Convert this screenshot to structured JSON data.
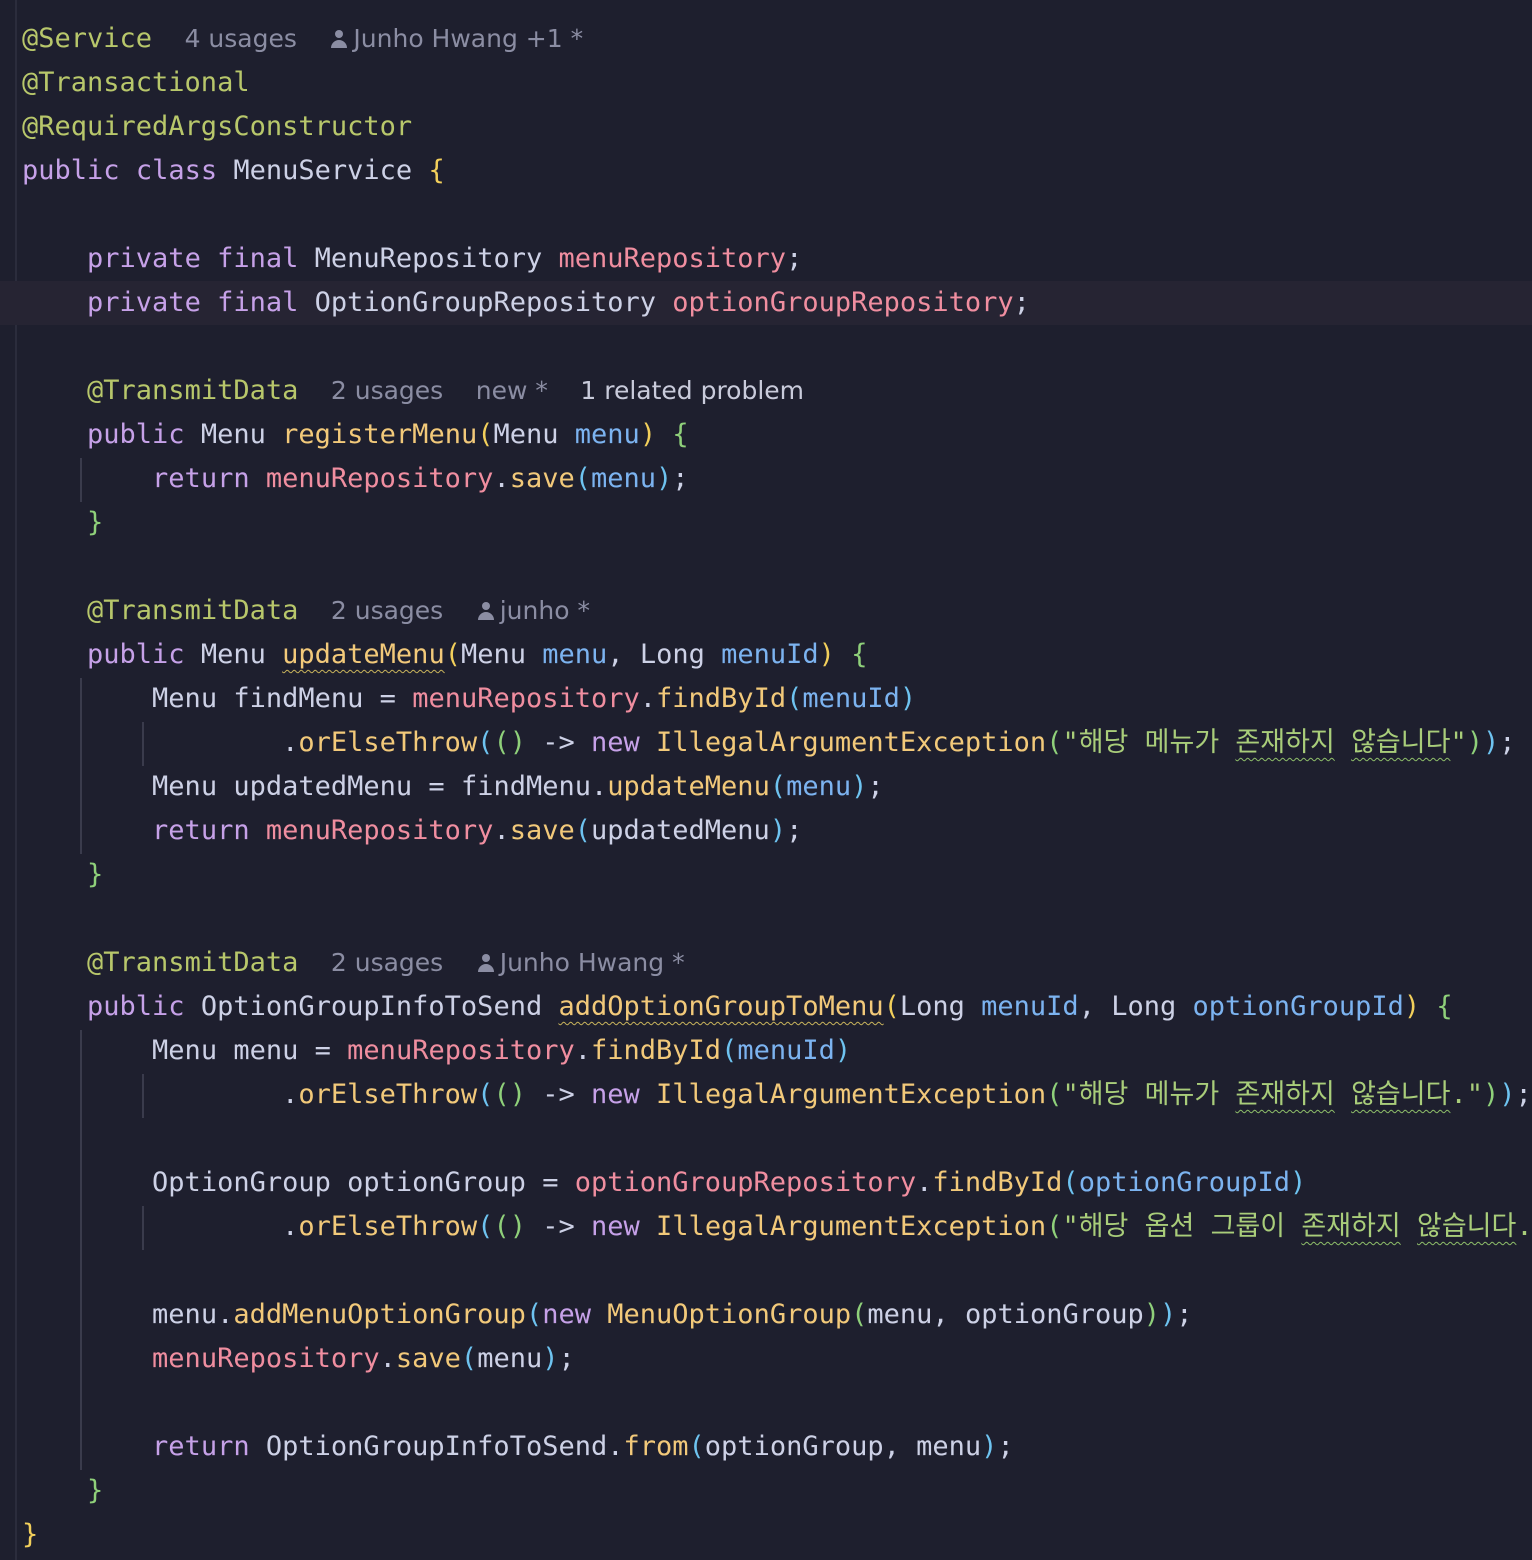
{
  "code": {
    "l1": {
      "ann": "@Service",
      "usages": "4 usages",
      "author": "Junho Hwang +1 *"
    },
    "l2": {
      "ann": "@Transactional"
    },
    "l3": {
      "ann": "@RequiredArgsConstructor"
    },
    "l4": {
      "kw1": "public",
      "kw2": "class",
      "name": "MenuService",
      "brace": "{"
    },
    "l6": {
      "kw1": "private",
      "kw2": "final",
      "type": "MenuRepository",
      "field": "menuRepository",
      "end": ";"
    },
    "l7": {
      "kw1": "private",
      "kw2": "final",
      "type": "OptionGroupRepository",
      "field": "optionGroupRepository",
      "end": ";"
    },
    "l9": {
      "ann": "@TransmitData",
      "usages": "2 usages",
      "status": "new *",
      "problem": "1 related problem"
    },
    "l10": {
      "kw": "public",
      "type": "Menu",
      "fn": "registerMenu",
      "p1": "(",
      "ptype": "Menu",
      "param": "menu",
      "p2": ")",
      "brace": "{"
    },
    "l11": {
      "kw": "return",
      "field": "menuRepository",
      "dot": ".",
      "fn": "save",
      "p1": "(",
      "arg": "menu",
      "p2": ")",
      "end": ";"
    },
    "l12": {
      "brace": "}"
    },
    "l14": {
      "ann": "@TransmitData",
      "usages": "2 usages",
      "author": "junho *"
    },
    "l15": {
      "kw": "public",
      "type": "Menu",
      "fn": "updateMenu",
      "p1": "(",
      "t1": "Menu",
      "a1": "menu",
      "comma": ",",
      "t2": "Long",
      "a2": "menuId",
      "p2": ")",
      "brace": "{"
    },
    "l16": {
      "type": "Menu",
      "var": "findMenu",
      "eq": "=",
      "field": "menuRepository",
      "dot": ".",
      "fn": "findById",
      "p1": "(",
      "arg": "menuId",
      "p2": ")"
    },
    "l17": {
      "dot": ".",
      "fn": "orElseThrow",
      "p1": "(",
      "lam": "()",
      "arrow": "->",
      "kw": "new",
      "cls": "IllegalArgumentException",
      "p2": "(",
      "s1": "\"해당 메뉴가 ",
      "s2": "존재하지",
      "s3": " ",
      "s4": "않습니다",
      ".": ".",
      "s5": "\"",
      "p3": ")",
      "p4": ")",
      "end": ";"
    },
    "l18": {
      "type": "Menu",
      "var": "updatedMenu",
      "eq": "=",
      "obj": "findMenu",
      "dot": ".",
      "fn": "updateMenu",
      "p1": "(",
      "arg": "menu",
      "p2": ")",
      "end": ";"
    },
    "l19": {
      "kw": "return",
      "field": "menuRepository",
      "dot": ".",
      "fn": "save",
      "p1": "(",
      "arg": "updatedMenu",
      "p2": ")",
      "end": ";"
    },
    "l20": {
      "brace": "}"
    },
    "l22": {
      "ann": "@TransmitData",
      "usages": "2 usages",
      "author": "Junho Hwang *"
    },
    "l23": {
      "kw": "public",
      "type": "OptionGroupInfoToSend",
      "fn": "addOptionGroupToMenu",
      "p1": "(",
      "t1": "Long",
      "a1": "menuId",
      "comma": ",",
      "t2": "Long",
      "a2": "optionGroupId",
      "p2": ")",
      "brace": "{"
    },
    "l24": {
      "type": "Menu",
      "var": "menu",
      "eq": "=",
      "field": "menuRepository",
      "dot": ".",
      "fn": "findById",
      "p1": "(",
      "arg": "menuId",
      "p2": ")"
    },
    "l25": {
      "dot": ".",
      "fn": "orElseThrow",
      "p1": "(",
      "lam": "()",
      "arrow": "->",
      "kw": "new",
      "cls": "IllegalArgumentException",
      "p2": "(",
      "s1": "\"해당 메뉴가 ",
      "s2": "존재하지",
      "s3": " ",
      "s4": "않습니다",
      "s5": ".\"",
      "p3": ")",
      "p4": ")",
      "end": ";"
    },
    "l27": {
      "type": "OptionGroup",
      "var": "optionGroup",
      "eq": "=",
      "field": "optionGroupRepository",
      "dot": ".",
      "fn": "findById",
      "p1": "(",
      "arg": "optionGroupId",
      "p2": ")"
    },
    "l28": {
      "dot": ".",
      "fn": "orElseThrow",
      "p1": "(",
      "lam": "()",
      "arrow": "->",
      "kw": "new",
      "cls": "IllegalArgumentException",
      "p2": "(",
      "s1": "\"해당 옵션 그룹이 ",
      "s2": "존재하지",
      "s3": " ",
      "s4": "않습니다",
      "s5": ".\"",
      "p3": ")",
      "p4": ")",
      "end": ";"
    },
    "l30": {
      "obj": "menu",
      "dot": ".",
      "fn": "addMenuOptionGroup",
      "p1": "(",
      "kw": "new",
      "cls": "MenuOptionGroup",
      "p2": "(",
      "a1": "menu",
      "comma": ",",
      "a2": "optionGroup",
      "p3": ")",
      "p4": ")",
      "end": ";"
    },
    "l31": {
      "field": "menuRepository",
      "dot": ".",
      "fn": "save",
      "p1": "(",
      "arg": "menu",
      "p2": ")",
      "end": ";"
    },
    "l33": {
      "kw": "return",
      "cls": "OptionGroupInfoToSend",
      "dot": ".",
      "fn": "from",
      "p1": "(",
      "a1": "optionGroup",
      "comma": ",",
      "a2": "menu",
      "p2": ")",
      "end": ";"
    },
    "l34": {
      "brace": "}"
    },
    "l35": {
      "brace": "}"
    }
  }
}
